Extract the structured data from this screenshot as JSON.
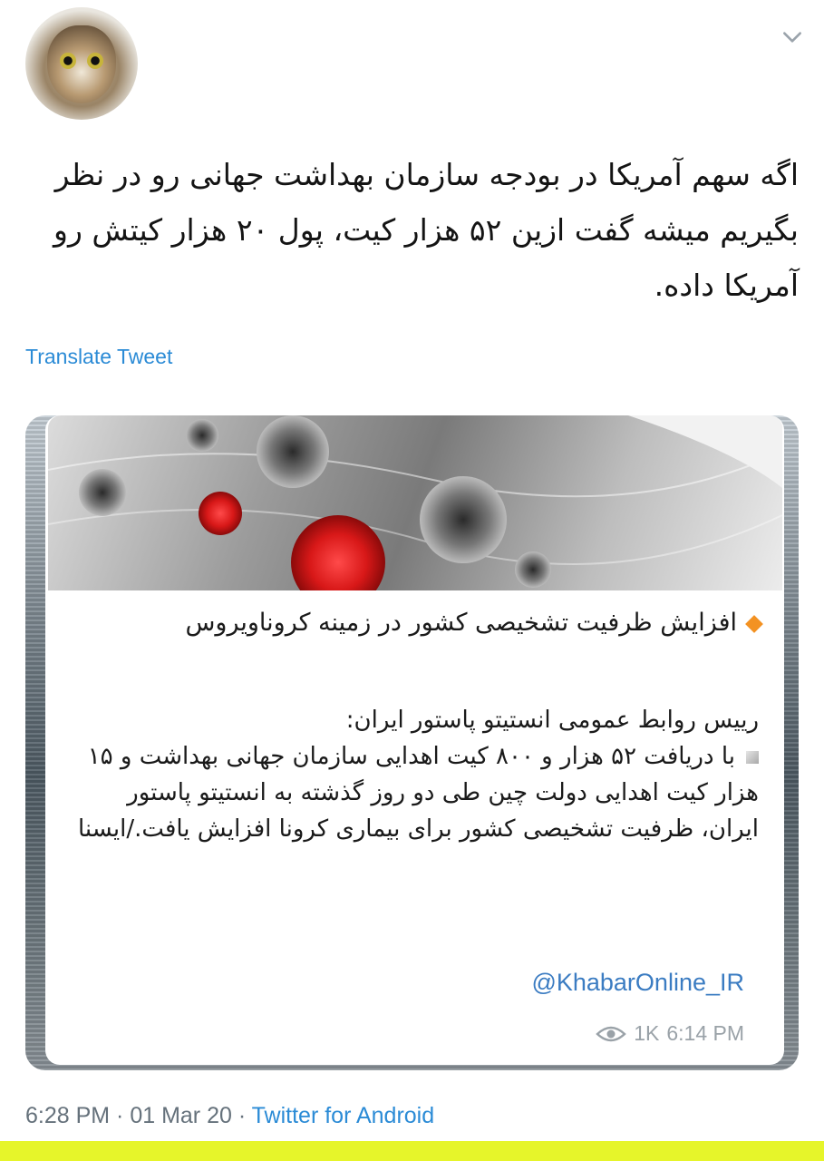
{
  "tweet": {
    "text": "اگه سهم آمریکا در بودجه سازمان بهداشت جهانی رو در نظر بگیریم میشه گفت ازین ۵۲ هزار کیت، پول ۲۰ هزار کیتش رو آمریکا داده.",
    "translate_label": "Translate Tweet",
    "timestamp": "6:28 PM · 01 Mar 20 · ",
    "source": "Twitter for Android"
  },
  "card": {
    "headline": "افزایش ظرفیت تشخیصی کشور در زمینه کروناویروس",
    "body_intro": "رییس روابط عمومی انستیتو پاستور ایران:",
    "body_main": "با دریافت ۵۲ هزار و ۸۰۰ کیت اهدایی سازمان جهانی بهداشت و ۱۵ هزار کیت اهدایی دولت چین طی دو روز گذشته به انستیتو پاستور ایران، ظرفیت تشخیصی کشور برای بیماری کرونا افزایش یافت./ایسنا",
    "channel_link": "@KhabarOnline_IR",
    "views": "1K",
    "time": "6:14 PM"
  },
  "icons": {
    "chevron": "chevron-down-icon",
    "views": "eye-icon",
    "bullet_headline": "orange-diamond-icon",
    "bullet_body": "gray-square-icon"
  },
  "colors": {
    "link_blue": "#2b8bd6",
    "channel_blue": "#3b7cc2",
    "accent_orange": "#f39222",
    "highlight_yellow": "#e6f52a"
  }
}
